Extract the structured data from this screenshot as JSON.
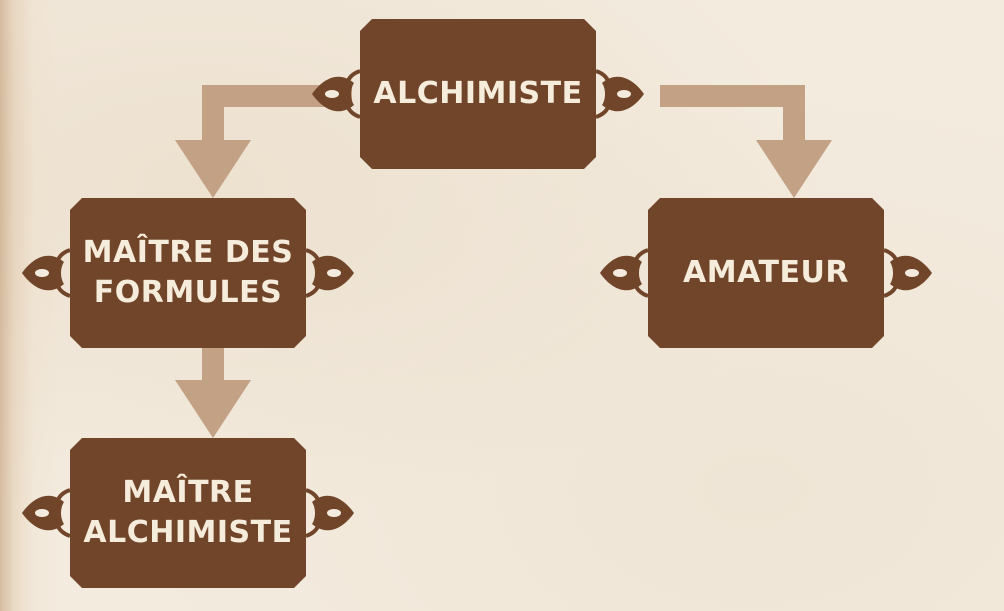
{
  "diagram": {
    "colors": {
      "background": "#f3ebde",
      "node_fill": "#714529",
      "node_text": "#f6ecdc",
      "connector": "#c2a185"
    },
    "nodes": {
      "root": {
        "label": "ALCHIMISTE"
      },
      "master_formulas": {
        "label": "MAÎTRE DES\nFORMULES"
      },
      "amateur": {
        "label": "AMATEUR"
      },
      "master_alchemist": {
        "label": "MAÎTRE\nALCHIMISTE"
      }
    },
    "edges": [
      {
        "from": "ALCHIMISTE",
        "to": "MAÎTRE DES FORMULES"
      },
      {
        "from": "ALCHIMISTE",
        "to": "AMATEUR"
      },
      {
        "from": "MAÎTRE DES FORMULES",
        "to": "MAÎTRE ALCHIMISTE"
      }
    ]
  }
}
